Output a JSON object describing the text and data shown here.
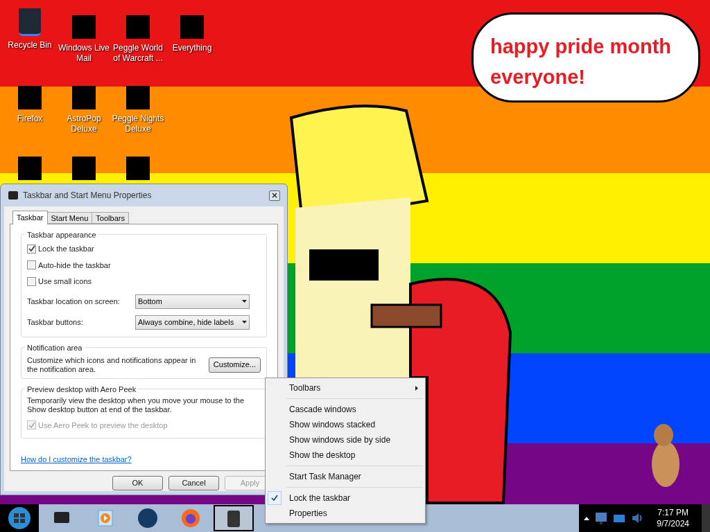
{
  "desktop_icons": [
    {
      "kind": "labeled",
      "label": "Recycle Bin",
      "color": "#1f2937"
    },
    {
      "kind": "labeled",
      "label": "Windows Live Mail",
      "color": "#000000"
    },
    {
      "kind": "labeled",
      "label": "Peggle World of Warcraft ...",
      "color": "#000000"
    },
    {
      "kind": "labeled",
      "label": "Everything",
      "color": "#000000"
    },
    {
      "kind": "labeled",
      "label": "Firefox",
      "color": "#000000"
    },
    {
      "kind": "labeled",
      "label": "AstroPop Deluxe",
      "color": "#000000"
    },
    {
      "kind": "labeled",
      "label": "Peggle Nights Deluxe",
      "color": "#000000"
    },
    {
      "kind": "icon_only",
      "color": "#000000"
    },
    {
      "kind": "icon_only",
      "color": "#000000"
    },
    {
      "kind": "icon_only",
      "color": "#000000"
    }
  ],
  "wallpaper": {
    "speech_bubble": "happy pride month everyone!"
  },
  "dialog": {
    "title": "Taskbar and Start Menu Properties",
    "tabs": [
      {
        "label": "Taskbar",
        "selected": true
      },
      {
        "label": "Start Menu",
        "selected": false
      },
      {
        "label": "Toolbars",
        "selected": false
      }
    ],
    "appearance": {
      "title": "Taskbar appearance",
      "checkboxes": [
        {
          "label": "Lock the taskbar",
          "checked": true
        },
        {
          "label": "Auto-hide the taskbar",
          "checked": false
        },
        {
          "label": "Use small icons",
          "checked": false
        }
      ],
      "dropdowns": [
        {
          "label": "Taskbar location on screen:",
          "value": "Bottom"
        },
        {
          "label": "Taskbar buttons:",
          "value": "Always combine, hide labels"
        }
      ]
    },
    "notification": {
      "title": "Notification area",
      "text": "Customize which icons and notifications appear in the notification area.",
      "button": "Customize..."
    },
    "peek": {
      "title": "Preview desktop with Aero Peek",
      "text": "Temporarily view the desktop when you move your mouse to the Show desktop button at end of the taskbar.",
      "checkbox": {
        "label": "Use Aero Peek to preview the desktop",
        "checked": true,
        "disabled": true
      }
    },
    "link": "How do I customize the taskbar?",
    "buttons": [
      {
        "label": "OK",
        "disabled": false
      },
      {
        "label": "Cancel",
        "disabled": false
      },
      {
        "label": "Apply",
        "disabled": true
      }
    ]
  },
  "context_menu": [
    {
      "kind": "submenu",
      "label": "Toolbars",
      "checked": false
    },
    {
      "kind": "separator"
    },
    {
      "kind": "item",
      "label": "Cascade windows",
      "checked": false
    },
    {
      "kind": "item",
      "label": "Show windows stacked",
      "checked": false
    },
    {
      "kind": "item",
      "label": "Show windows side by side",
      "checked": false
    },
    {
      "kind": "item",
      "label": "Show the desktop",
      "checked": false
    },
    {
      "kind": "separator"
    },
    {
      "kind": "item",
      "label": "Start Task Manager",
      "checked": false
    },
    {
      "kind": "separator"
    },
    {
      "kind": "item",
      "label": "Lock the taskbar",
      "checked": true
    },
    {
      "kind": "item",
      "label": "Properties",
      "checked": false
    }
  ],
  "taskbar": {
    "buttons": [
      {
        "selected": false
      },
      {
        "selected": false
      },
      {
        "selected": false
      },
      {
        "selected": false
      },
      {
        "selected": true
      }
    ],
    "clock": {
      "time": "7:17 PM",
      "date": "9/7/2024"
    }
  }
}
